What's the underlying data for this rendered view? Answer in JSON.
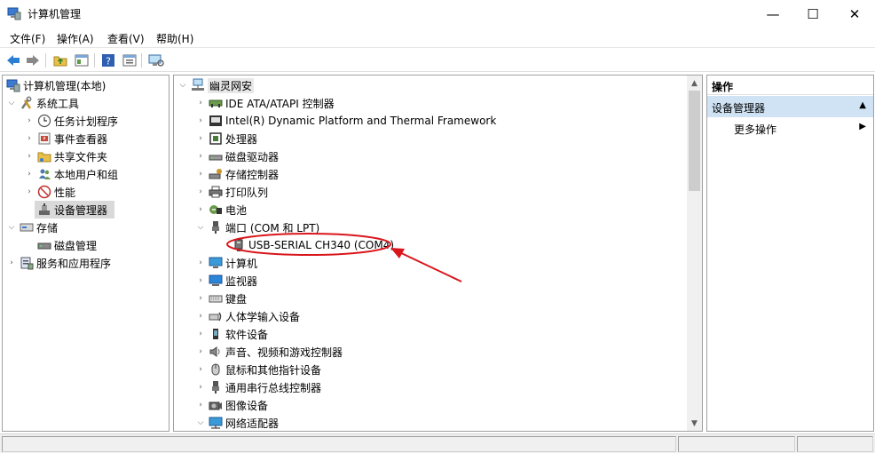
{
  "window": {
    "title": "计算机管理",
    "minimize": "—",
    "maximize": "☐",
    "close": "✕"
  },
  "menu": [
    "文件(F)",
    "操作(A)",
    "查看(V)",
    "帮助(H)"
  ],
  "left_tree": {
    "root": "计算机管理(本地)",
    "system_tools": "系统工具",
    "task_scheduler": "任务计划程序",
    "event_viewer": "事件查看器",
    "shared_folders": "共享文件夹",
    "local_users": "本地用户和组",
    "performance": "性能",
    "device_manager": "设备管理器",
    "storage": "存储",
    "disk_management": "磁盘管理",
    "services": "服务和应用程序"
  },
  "device_tree": {
    "computer_name": "幽灵网安",
    "categories": [
      "IDE ATA/ATAPI 控制器",
      "Intel(R) Dynamic Platform and Thermal Framework",
      "处理器",
      "磁盘驱动器",
      "存储控制器",
      "打印队列",
      "电池",
      "端口 (COM 和 LPT)",
      "USB-SERIAL CH340 (COM4)",
      "计算机",
      "监视器",
      "键盘",
      "人体学输入设备",
      "软件设备",
      "声音、视频和游戏控制器",
      "鼠标和其他指针设备",
      "通用串行总线控制器",
      "图像设备",
      "网络适配器"
    ]
  },
  "actions": {
    "header": "操作",
    "section": "设备管理器",
    "more": "更多操作"
  },
  "colors": {
    "annotation": "#d9161c",
    "section_bg": "#cfe3f5",
    "selected_bg": "#d9d9d9"
  }
}
